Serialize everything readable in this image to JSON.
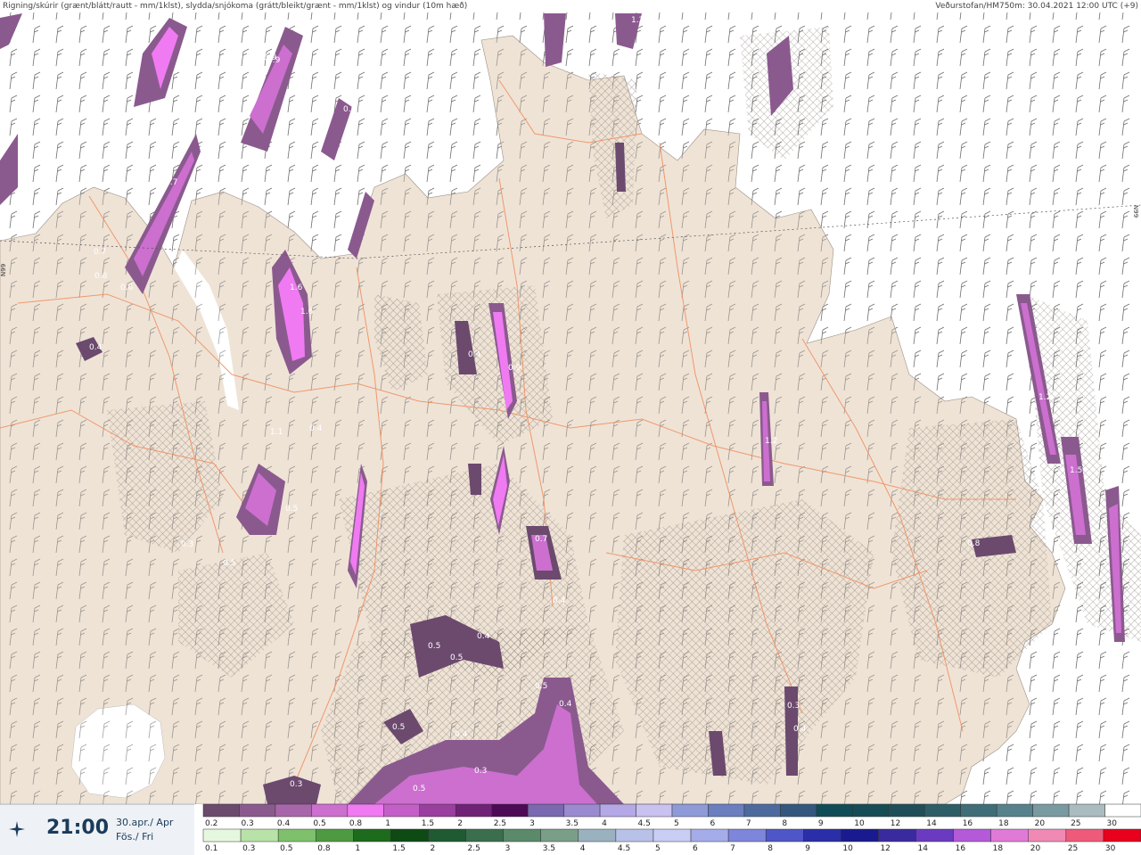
{
  "header": {
    "left": "Rigning/skúrir (grænt/blátt/rautt - mm/1klst), slydda/snjókoma (grátt/bleikt/grænt - mm/1klst) og vindur (10m hæð)",
    "right": "Veðurstofan/HM750m: 30.04.2021 12:00 UTC (+9)"
  },
  "map_labels": {
    "lat_left": "N99",
    "lat_right": "N99"
  },
  "time_panel": {
    "time": "21:00",
    "date_line1": "30.apr./ Apr",
    "date_line2": "Fös./ Fri",
    "icon": "compass-star-icon"
  },
  "legend_top": {
    "labels": [
      "0.2",
      "0.3",
      "0.4",
      "0.5",
      "0.8",
      "1",
      "1.5",
      "2",
      "2.5",
      "3",
      "3.5",
      "4",
      "4.5",
      "5",
      "6",
      "7",
      "8",
      "9",
      "10",
      "12",
      "14",
      "16",
      "18",
      "20",
      "25",
      "30"
    ],
    "colors": [
      "#6b4a6e",
      "#8a5a8e",
      "#a866aa",
      "#cc6fcf",
      "#f07af2",
      "#c45fc8",
      "#9a3ea0",
      "#702277",
      "#4d0a55",
      "#7a68b0",
      "#9a8ad0",
      "#b4a8e6",
      "#c9c2f0",
      "#8f9ad8",
      "#6a7ec0",
      "#4d6a9e",
      "#35577e",
      "#0e4d58",
      "#164c56",
      "#1f4e5a",
      "#2d5e68",
      "#406e78",
      "#57828c",
      "#7a9aa2",
      "#aabcc0",
      "#ffffff"
    ]
  },
  "legend_bottom": {
    "labels": [
      "0.1",
      "0.3",
      "0.5",
      "0.8",
      "1",
      "1.5",
      "2",
      "2.5",
      "3",
      "3.5",
      "4",
      "4.5",
      "5",
      "6",
      "7",
      "8",
      "9",
      "10",
      "12",
      "14",
      "16",
      "18",
      "20",
      "25",
      "30"
    ],
    "colors": [
      "#e6f7df",
      "#b8e2a8",
      "#7fc06c",
      "#4e9a42",
      "#1d6b1c",
      "#0d4a14",
      "#1e5a32",
      "#3a6e4c",
      "#5a8a6a",
      "#7a9e88",
      "#9ab2c0",
      "#b8c2e8",
      "#c8cef4",
      "#a4acea",
      "#7e86dc",
      "#4e56c8",
      "#2a2ea8",
      "#1a1a90",
      "#3a2aa0",
      "#6a3ac0",
      "#b45ad8",
      "#e07ad8",
      "#f08ab4",
      "#f05a7a",
      "#e8001c"
    ]
  },
  "precip_labels": [
    "0.7",
    "0.9",
    "0.6",
    "0.4",
    "0.7",
    "0.8",
    "0.6",
    "0.4",
    "1.6",
    "1.6",
    "0.9",
    "0.4",
    "0.7",
    "0.4",
    "1.1",
    "0.5",
    "0.3",
    "0.4",
    "0.5",
    "0.5",
    "0.4",
    "0.3",
    "0.5",
    "0.4",
    "0.5",
    "0.3",
    "0.4",
    "1.2",
    "1.2",
    "1.5",
    "1.9",
    "0.4",
    "1.2",
    "0.5",
    "0.3",
    "0.8",
    "0.5"
  ],
  "colors": {
    "land": "#efe3d6",
    "sea": "#ffffff",
    "roads": "#f08c5a",
    "hatch": "#8a7d72"
  }
}
